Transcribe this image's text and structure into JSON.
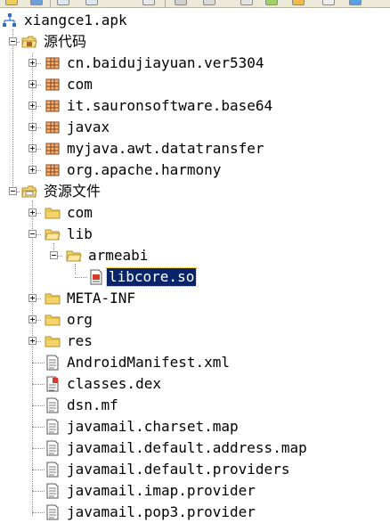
{
  "tree": {
    "root": {
      "label": "xiangce1.apk",
      "icon": "apk-tree-icon"
    },
    "source_node": {
      "label": "源代码",
      "icon": "package-folder-icon",
      "expanded": true
    },
    "packages": [
      {
        "label": "cn.baidujiayuan.ver5304"
      },
      {
        "label": "com"
      },
      {
        "label": "it.sauronsoftware.base64"
      },
      {
        "label": "javax"
      },
      {
        "label": "myjava.awt.datatransfer"
      },
      {
        "label": "org.apache.harmony"
      }
    ],
    "resources_node": {
      "label": "资源文件",
      "icon": "resources-folder-icon",
      "expanded": true
    },
    "resources": {
      "com": "com",
      "lib": "lib",
      "armeabi": "armeabi",
      "libcore": "libcore.so",
      "meta_inf": "META-INF",
      "org": "org",
      "res": "res"
    },
    "files": [
      {
        "label": "AndroidManifest.xml",
        "icon": "document-icon"
      },
      {
        "label": "classes.dex",
        "icon": "dex-file-icon"
      },
      {
        "label": "dsn.mf",
        "icon": "document-icon"
      },
      {
        "label": "javamail.charset.map",
        "icon": "document-icon"
      },
      {
        "label": "javamail.default.address.map",
        "icon": "document-icon"
      },
      {
        "label": "javamail.default.providers",
        "icon": "document-icon"
      },
      {
        "label": "javamail.imap.provider",
        "icon": "document-icon"
      },
      {
        "label": "javamail.pop3.provider",
        "icon": "document-icon"
      }
    ],
    "selected": "libcore.so",
    "colors": {
      "selection_bg": "#0a246a",
      "selection_text": "#ffffff",
      "folder_yellow": "#f5d46a",
      "package_brown": "#b0622a"
    }
  }
}
